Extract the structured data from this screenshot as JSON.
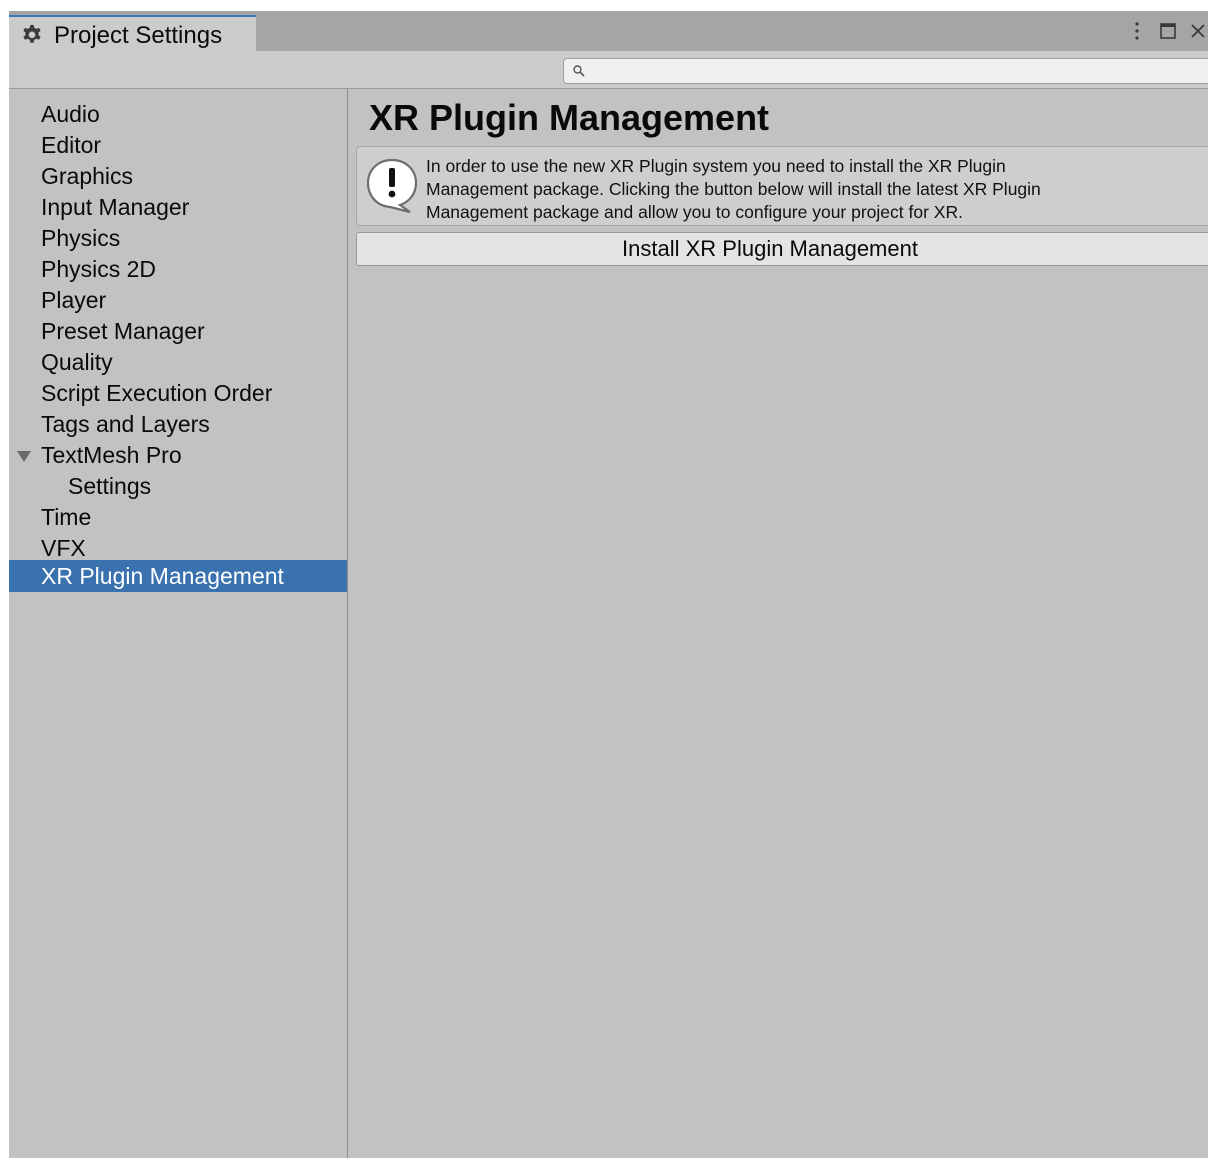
{
  "tab": {
    "title": "Project Settings",
    "icon": "gear-icon"
  },
  "window_controls": {
    "menu_icon": "kebab-menu-icon",
    "maximize_icon": "maximize-icon",
    "close_icon": "close-icon"
  },
  "search": {
    "value": "",
    "placeholder": "",
    "icon": "search-icon"
  },
  "sidebar": {
    "items": [
      {
        "label": "Audio"
      },
      {
        "label": "Editor"
      },
      {
        "label": "Graphics"
      },
      {
        "label": "Input Manager"
      },
      {
        "label": "Physics"
      },
      {
        "label": "Physics 2D"
      },
      {
        "label": "Player"
      },
      {
        "label": "Preset Manager"
      },
      {
        "label": "Quality"
      },
      {
        "label": "Script Execution Order"
      },
      {
        "label": "Tags and Layers"
      },
      {
        "label": "TextMesh Pro",
        "expanded": true
      },
      {
        "label": "Settings",
        "child": true
      },
      {
        "label": "Time"
      },
      {
        "label": "VFX"
      },
      {
        "label": "XR Plugin Management",
        "selected": true
      }
    ]
  },
  "main": {
    "title": "XR Plugin Management",
    "help": {
      "icon": "warning-icon",
      "lines": [
        "In order to use the new XR Plugin system you need to install the XR Plugin",
        "Management package. Clicking the button below will install the latest XR Plugin",
        "Management package and allow you to configure your project for XR."
      ]
    },
    "install_button_label": "Install XR Plugin Management"
  },
  "colors": {
    "selection": "#3a72b0",
    "tab_accent": "#3a79bb",
    "panel_background": "#c2c2c2"
  }
}
